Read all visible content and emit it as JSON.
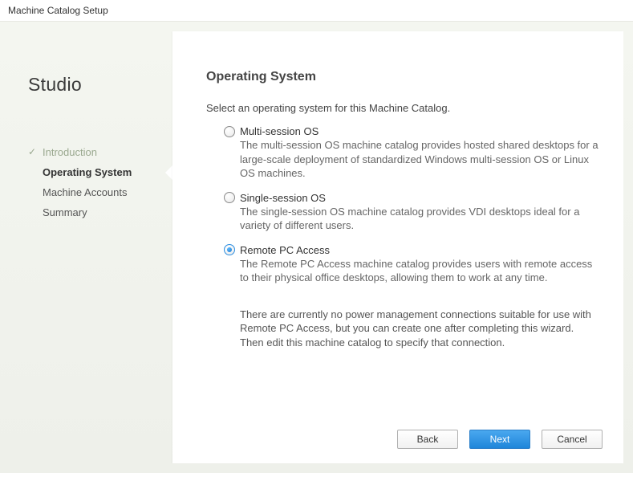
{
  "window": {
    "title": "Machine Catalog Setup"
  },
  "sidebar": {
    "brand": "Studio",
    "items": [
      {
        "label": "Introduction",
        "state": "completed"
      },
      {
        "label": "Operating System",
        "state": "current"
      },
      {
        "label": "Machine Accounts",
        "state": "pending"
      },
      {
        "label": "Summary",
        "state": "pending"
      }
    ]
  },
  "panel": {
    "heading": "Operating System",
    "subtitle": "Select an operating system for this Machine Catalog.",
    "options": [
      {
        "id": "multi-session-os",
        "label": "Multi-session OS",
        "description": "The multi-session OS machine catalog provides hosted shared desktops for a large-scale deployment of standardized Windows multi-session OS or Linux OS machines.",
        "selected": false
      },
      {
        "id": "single-session-os",
        "label": "Single-session OS",
        "description": "The single-session OS machine catalog provides VDI desktops ideal for a variety of different users.",
        "selected": false
      },
      {
        "id": "remote-pc-access",
        "label": "Remote PC Access",
        "description": "The Remote PC Access machine catalog provides users with remote access to their physical office desktops, allowing them to work at any time.",
        "selected": true
      }
    ],
    "info": "There are currently no power management connections suitable for use with Remote PC Access, but you can create one after completing this wizard. Then edit this machine catalog to specify that connection."
  },
  "buttons": {
    "back": "Back",
    "next": "Next",
    "cancel": "Cancel"
  }
}
